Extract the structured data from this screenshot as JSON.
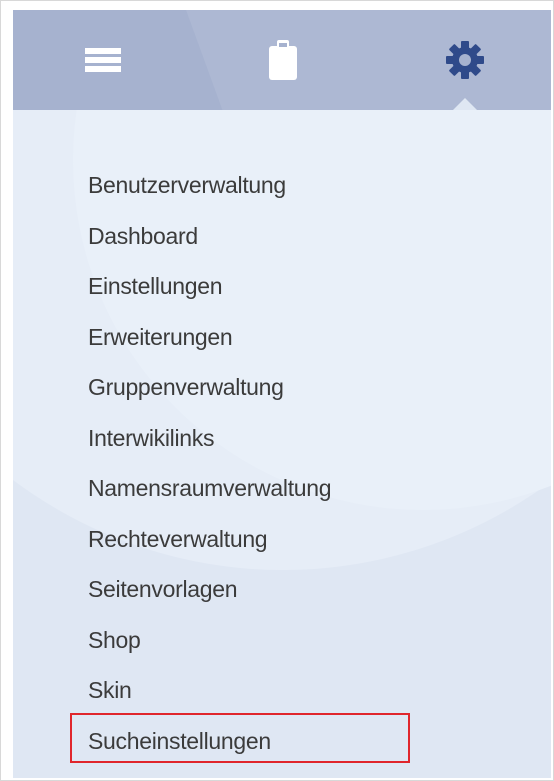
{
  "tabs": [
    {
      "icon": "menu-icon",
      "active": false
    },
    {
      "icon": "clipboard-icon",
      "active": false
    },
    {
      "icon": "gear-icon",
      "active": true
    }
  ],
  "menu": {
    "items": [
      "Benutzerverwaltung",
      "Dashboard",
      "Einstellungen",
      "Erweiterungen",
      "Gruppenverwaltung",
      "Interwikilinks",
      "Namensraumverwaltung",
      "Rechteverwaltung",
      "Seitenvorlagen",
      "Shop",
      "Skin",
      "Sucheinstellungen"
    ],
    "highlighted_item": "Sucheinstellungen"
  },
  "colors": {
    "tabbar": "#a6b2cf",
    "panel": "#dfe7f3",
    "icon_white": "#ffffff",
    "icon_active": "#2f4a8a",
    "text": "#3b3b3b",
    "highlight_border": "#e0262c"
  }
}
